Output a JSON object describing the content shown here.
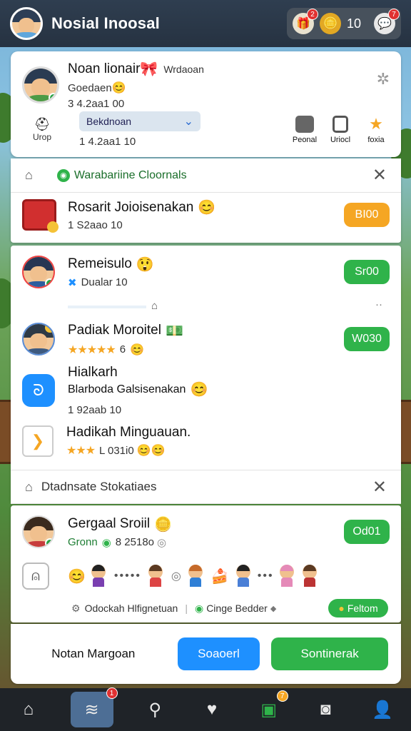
{
  "app": {
    "title": "Nosial Inoosal"
  },
  "topbar": {
    "notif_badge": "2",
    "coins": "10",
    "alert_badge": "7"
  },
  "profile": {
    "name": "Noan lionair",
    "tag": "Wrdaoan",
    "status": "Goedaen",
    "score": "3 4.2aa1 00",
    "select_value": "Bekdnoan",
    "count": "1 4.2aa1 10",
    "left_action": "Urop",
    "actions": [
      "Peonal",
      "Uriocl",
      "foxia"
    ]
  },
  "section1": {
    "title": "Warabariine Cloornals",
    "item": {
      "title": "Rosarit Joioisenakan",
      "sub": "1 S2aao 10",
      "button": "BI00"
    }
  },
  "section2": {
    "items": [
      {
        "title": "Remeisulo",
        "sub": "Dualar 10",
        "button": "Sr00"
      },
      {
        "title": "Padiak Moroitel",
        "sub": "6",
        "button": "W030"
      },
      {
        "title": "Hialkarh",
        "sub": "Blarboda Galsisenakan",
        "sub2": "1 92aab 10"
      },
      {
        "title": "Hadikah Minguauan.",
        "sub": "L 031i0"
      }
    ]
  },
  "section3": {
    "title": "Dtadnsate Stokatiaes",
    "item": {
      "title": "Gergaal Sroiil",
      "sub_a": "Gronn",
      "sub_b": "8 2518o",
      "button": "Od01"
    },
    "link_left": "Odockah Hlfignetuan",
    "link_right": "Cinge Bedder",
    "follow_button": "Feltom"
  },
  "footer": {
    "text_button": "Notan Margoan",
    "primary_button": "Soaoerl",
    "green_button": "Sontinerak"
  },
  "nav": {
    "badge_1": "1",
    "badge_2": "7"
  },
  "colors": {
    "green": "#2fb34a",
    "orange": "#f5a623",
    "blue": "#1e90ff",
    "topbar": "#2c3a4b"
  }
}
